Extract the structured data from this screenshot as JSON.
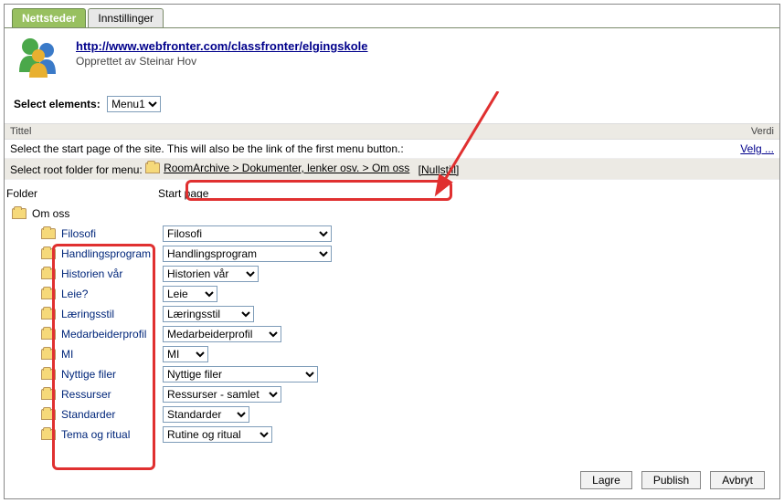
{
  "tabs": {
    "active": "Nettsteder",
    "other": "Innstillinger"
  },
  "header": {
    "url": "http://www.webfronter.com/classfronter/elgingskole",
    "created": "Opprettet av Steinar Hov"
  },
  "selectElements": {
    "label": "Select elements:",
    "value": "Menu1"
  },
  "listHeaders": {
    "title": "Tittel",
    "value": "Verdi"
  },
  "startPageRow": {
    "text": "Select the start page of the site. This will also be the link of the first menu button.:",
    "action": "Velg ..."
  },
  "rootFolderRow": {
    "label": "Select root folder for menu:",
    "breadcrumb": "RoomArchive > Dokumenter, lenker osv. > Om oss",
    "reset": "[Nullstill]"
  },
  "folderCols": {
    "folder": "Folder",
    "start": "Start page"
  },
  "rootFolder": "Om oss",
  "items": [
    {
      "label": "Filosofi",
      "select": "Filosofi"
    },
    {
      "label": "Handlingsprogram",
      "select": "Handlingsprogram"
    },
    {
      "label": "Historien vår",
      "select": "Historien vår"
    },
    {
      "label": "Leie?",
      "select": "Leie"
    },
    {
      "label": "Læringsstil",
      "select": "Læringsstil"
    },
    {
      "label": "Medarbeiderprofil",
      "select": "Medarbeiderprofil"
    },
    {
      "label": "MI",
      "select": "MI"
    },
    {
      "label": "Nyttige filer",
      "select": "Nyttige filer"
    },
    {
      "label": "Ressurser",
      "select": "Ressurser - samlet"
    },
    {
      "label": "Standarder",
      "select": "Standarder"
    },
    {
      "label": "Tema og ritual",
      "select": "Rutine og ritual"
    }
  ],
  "buttons": {
    "save": "Lagre",
    "publish": "Publish",
    "cancel": "Avbryt"
  }
}
